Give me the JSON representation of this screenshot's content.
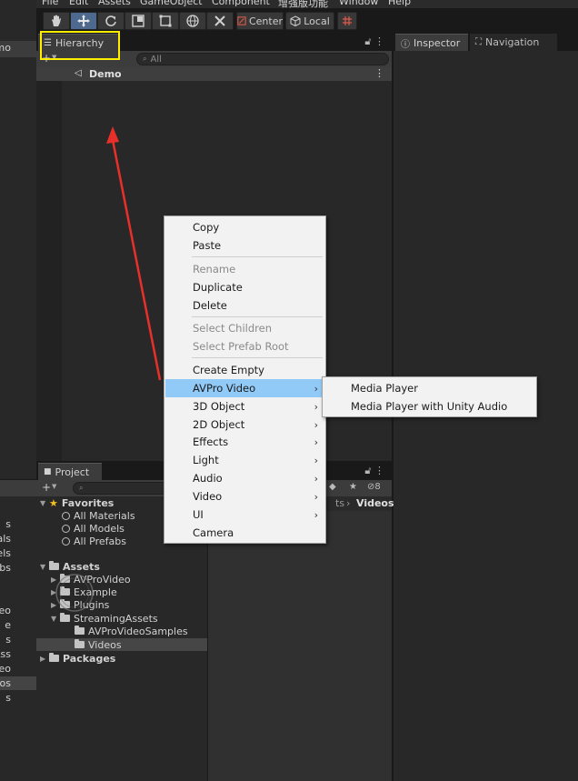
{
  "left_strip": {
    "items": [
      "mo",
      "s",
      "erials",
      "dels",
      "fabs",
      "Video",
      "e",
      "s",
      "ingAss",
      "roVideo",
      "eos",
      "s"
    ]
  },
  "menubar": {
    "items": [
      "File",
      "Edit",
      "Assets",
      "GameObject",
      "Component",
      "增强版功能",
      "Window",
      "Help"
    ]
  },
  "toolbar": {
    "pivot_label": "Center",
    "space_label": "Local"
  },
  "hierarchy": {
    "tab_label": "Hierarchy",
    "add_label": "+",
    "search_placeholder": "All",
    "scene_name": "Demo"
  },
  "inspector": {
    "tab_inspector": "Inspector",
    "tab_navigation": "Navigation"
  },
  "project": {
    "tab_label": "Project",
    "add_label": "+",
    "hidden_count": "8",
    "breadcrumb_parent": "ts",
    "breadcrumb_current": "Videos",
    "partial_text_1": "5",
    "partial_text_2": "8",
    "favorites": {
      "label": "Favorites",
      "items": [
        "All Materials",
        "All Models",
        "All Prefabs"
      ]
    },
    "assets": {
      "label": "Assets",
      "children": [
        "AVProVideo",
        "Example",
        "Plugins"
      ],
      "streaming": "StreamingAssets",
      "streaming_children": [
        "AVProVideoSamples",
        "Videos"
      ]
    },
    "packages_label": "Packages"
  },
  "context_menu": {
    "copy": "Copy",
    "paste": "Paste",
    "rename": "Rename",
    "duplicate": "Duplicate",
    "delete": "Delete",
    "select_children": "Select Children",
    "select_prefab_root": "Select Prefab Root",
    "create_empty": "Create Empty",
    "avpro_video": "AVPro Video",
    "object_3d": "3D Object",
    "object_2d": "2D Object",
    "effects": "Effects",
    "light": "Light",
    "audio": "Audio",
    "video": "Video",
    "ui": "UI",
    "camera": "Camera"
  },
  "submenu": {
    "media_player": "Media Player",
    "media_player_unity_audio": "Media Player with Unity Audio"
  },
  "colors": {
    "highlight_box": "#ffee00",
    "annotation_arrow": "#e8302a",
    "menu_highlight": "#91c9f7",
    "active_tool": "#4d6a8e"
  }
}
